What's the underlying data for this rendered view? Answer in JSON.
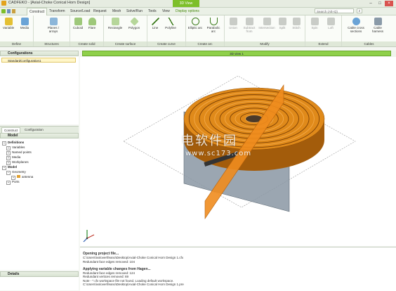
{
  "window": {
    "title": "CADFEKO - [Axial-Choke Conical Horn Design]",
    "context_tab": "3D View"
  },
  "tabs": [
    "Construct",
    "Transform",
    "Source/Load",
    "Request",
    "Mesh",
    "Solve/Run",
    "Tools",
    "View",
    "Display options"
  ],
  "search": {
    "placeholder": "Search (Alt+Q)"
  },
  "ribbon": {
    "groups": [
      {
        "label": "Define",
        "buttons": [
          "Variable",
          "Media"
        ]
      },
      {
        "label": "Structures",
        "buttons": [
          "Planes / arrays"
        ]
      },
      {
        "label": "Create solid",
        "buttons": [
          "Cuboid",
          "Flare"
        ]
      },
      {
        "label": "Create surface",
        "buttons": [
          "Rectangle",
          "Polygon"
        ]
      },
      {
        "label": "Create curve",
        "buttons": [
          "Line",
          "Polyline"
        ]
      },
      {
        "label": "Create arc",
        "buttons": [
          "Elliptic arc",
          "Parabolic arc"
        ]
      },
      {
        "label": "Modify",
        "buttons": [
          "Union",
          "Subtract from",
          "Intersection",
          "Split",
          "Stitch"
        ]
      },
      {
        "label": "Extend",
        "buttons": [
          "Spin",
          "Loft"
        ]
      },
      {
        "label": "Cables",
        "buttons": [
          "Cable cross sections",
          "Cable harness"
        ]
      }
    ]
  },
  "configurations": {
    "title": "Configurations",
    "items": [
      "StandardConfiguration1"
    ]
  },
  "subtabs": [
    "Construct",
    "Configuration"
  ],
  "tree": {
    "title": "Model",
    "nodes": [
      {
        "label": "Definitions",
        "bold": true,
        "depth": 0
      },
      {
        "label": "Variables",
        "bold": false,
        "depth": 1
      },
      {
        "label": "Named points",
        "bold": false,
        "depth": 1
      },
      {
        "label": "Media",
        "bold": false,
        "depth": 1
      },
      {
        "label": "Workplanes",
        "bold": false,
        "depth": 1
      },
      {
        "label": "Model",
        "bold": true,
        "depth": 0
      },
      {
        "label": "Geometry",
        "bold": false,
        "depth": 1
      },
      {
        "label": "antenna",
        "bold": false,
        "depth": 2
      },
      {
        "label": "Ports",
        "bold": false,
        "depth": 1
      }
    ]
  },
  "details": {
    "title": "Details"
  },
  "view": {
    "tab_label": "3D view 1"
  },
  "log": [
    {
      "text": "Opening project file...",
      "bold": true
    },
    {
      "text": "C:\\Users\\ivxlover\\feano\\Desktop\\Axial-Choke Conical Horn Design 1.cfx",
      "bold": false
    },
    {
      "text": "Redundant face edges removed: 104",
      "bold": false
    },
    {
      "text": "",
      "bold": false
    },
    {
      "text": "Applying variable changes from Hagen...",
      "bold": true
    },
    {
      "text": "Redundant face edges removed: 124",
      "bold": false
    },
    {
      "text": "Redundant vertices removed: 69",
      "bold": false
    },
    {
      "text": "Note - *.cfx workspace file not found. Loading default workspace.",
      "bold": false
    },
    {
      "text": "C:\\Users\\ivxlover\\feano\\Desktop\\Axial-Choke Conical Horn Design 1.pre",
      "bold": false
    }
  ],
  "watermark": {
    "line1": "电软件园",
    "line2": "www.sc173.com"
  },
  "colors": {
    "accent": "#7dbf2a",
    "model_orange": "#e08a1a",
    "plane_gray": "#7c8a96"
  }
}
